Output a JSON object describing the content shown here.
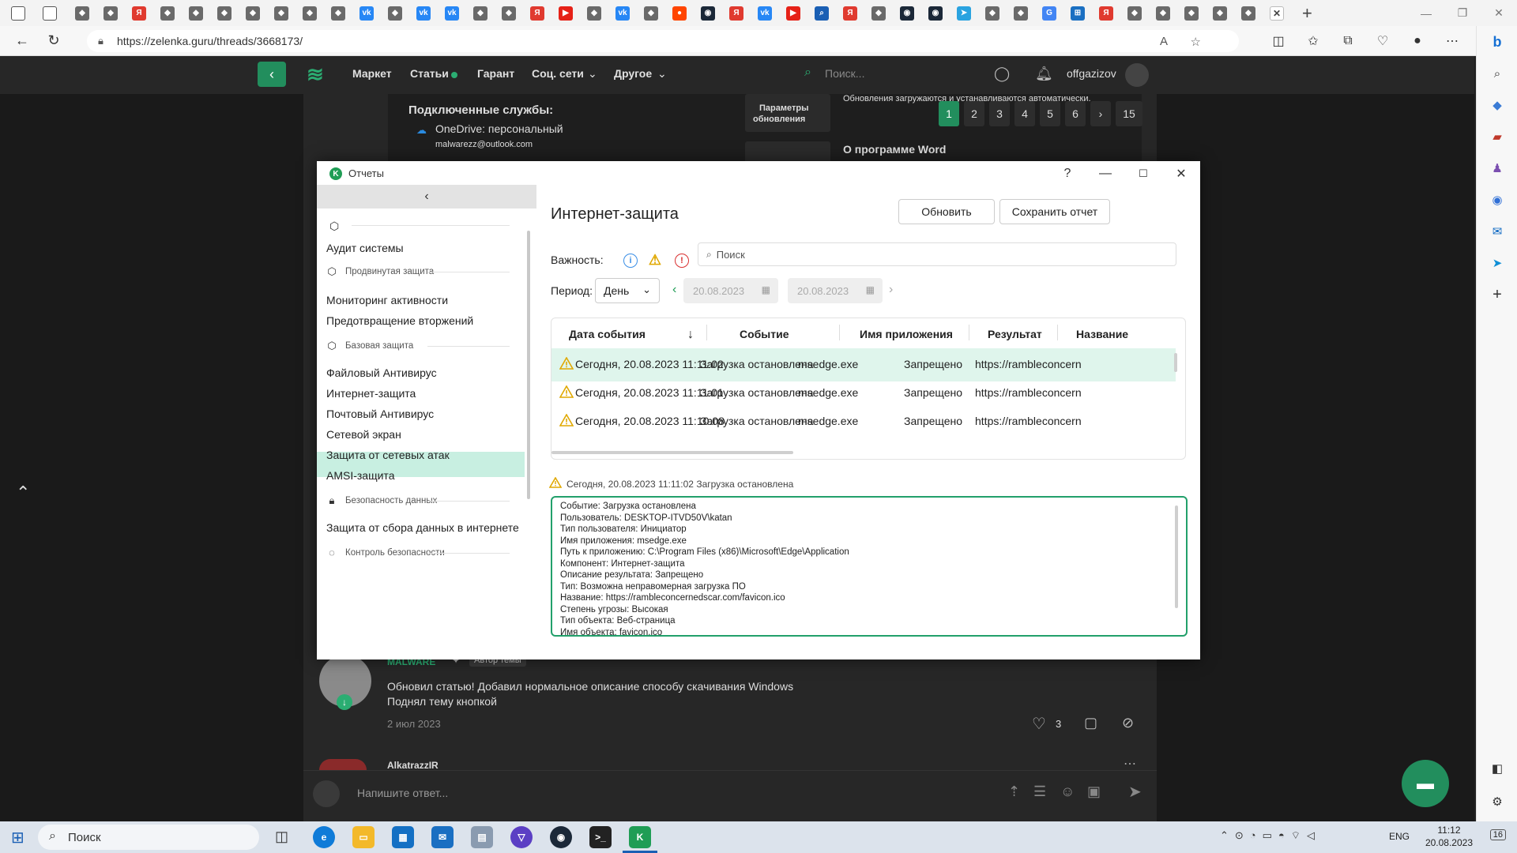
{
  "browser": {
    "url": "https://zelenka.guru/threads/3668173/",
    "tab_icons": [
      "tab-icon",
      "tab-icon",
      "yandex-icon",
      "tab-icon",
      "tab-icon",
      "tab-icon",
      "tab-icon",
      "tab-icon",
      "tab-icon",
      "tab-icon",
      "vk-icon",
      "tab-icon",
      "vk-icon",
      "vk-icon",
      "tab-icon",
      "tab-icon",
      "yandex-icon",
      "youtube-icon",
      "tab-icon",
      "vk-icon",
      "tab-icon",
      "reddit-icon",
      "steam-icon",
      "yandex-icon",
      "vk-icon",
      "youtube-icon",
      "search-icon",
      "yandex-icon",
      "tab-icon",
      "steam-icon",
      "steam-icon",
      "telegram-icon",
      "tab-icon",
      "tab-icon",
      "google-icon",
      "windows-icon",
      "yandex-icon",
      "tab-icon",
      "tab-icon",
      "tab-icon",
      "tab-icon",
      "tab-icon"
    ]
  },
  "site": {
    "nav": [
      "Маркет",
      "Статьи",
      "Гарант",
      "Соц. сети",
      "Другое"
    ],
    "search_placeholder": "Поиск...",
    "username": "offgazizov",
    "bg_snippets": {
      "connected_services": "Подключенные службы:",
      "onedrive": "OneDrive: персональный",
      "email": "malwarezz@outlook.com",
      "update_params_line1": "Параметры",
      "update_params_line2": "обновления",
      "updates_auto": "Обновления загружаются и устанавливаются автоматически.",
      "about_word": "О программе Word"
    },
    "pagination": [
      "1",
      "2",
      "3",
      "4",
      "5",
      "6",
      "›",
      "15"
    ],
    "post": {
      "author": "MALWARE",
      "badge": "Автор темы",
      "text_line1": "Обновил статью! Добавил нормальное описание способу скачивания Windows",
      "text_line2": "Поднял тему кнопкой",
      "date": "2 июл 2023",
      "likes": "3",
      "next_author": "AlkatrazzIR"
    },
    "reply_placeholder": "Напишите ответ..."
  },
  "kaspersky": {
    "window_title": "Отчеты",
    "help": "?",
    "sidebar": {
      "items": [
        {
          "type": "item",
          "label": "Аудит системы"
        },
        {
          "type": "group",
          "label": "Продвинутая защита"
        },
        {
          "type": "item",
          "label": "Мониторинг активности"
        },
        {
          "type": "item",
          "label": "Предотвращение вторжений"
        },
        {
          "type": "group",
          "label": "Базовая защита"
        },
        {
          "type": "item",
          "label": "Файловый Антивирус"
        },
        {
          "type": "item",
          "label": "Интернет-защита"
        },
        {
          "type": "item",
          "label": "Почтовый Антивирус"
        },
        {
          "type": "item",
          "label": "Сетевой экран"
        },
        {
          "type": "item",
          "label": "Защита от сетевых атак"
        },
        {
          "type": "item",
          "label": "AMSI-защита"
        },
        {
          "type": "group",
          "label": "Безопасность данных"
        },
        {
          "type": "item",
          "label": "Защита от сбора данных в интернете"
        },
        {
          "type": "group",
          "label": "Контроль безопасности"
        }
      ]
    },
    "heading": "Интернет-защита",
    "refresh_btn": "Обновить",
    "save_btn": "Сохранить отчет",
    "severity_label": "Важность:",
    "search_placeholder": "Поиск",
    "period_label": "Период:",
    "period_value": "День",
    "date_from": "20.08.2023",
    "date_to": "20.08.2023",
    "columns": [
      "Дата события",
      "Событие",
      "Имя приложения",
      "Результат",
      "Название"
    ],
    "rows": [
      {
        "date": "Сегодня, 20.08.2023 11:11:02",
        "event": "Загрузка остановлена",
        "app": "msedge.exe",
        "result": "Запрещено",
        "name": "https://rambleconcern"
      },
      {
        "date": "Сегодня, 20.08.2023 11:11:01",
        "event": "Загрузка остановлена",
        "app": "msedge.exe",
        "result": "Запрещено",
        "name": "https://rambleconcern"
      },
      {
        "date": "Сегодня, 20.08.2023 11:10:08",
        "event": "Загрузка остановлена",
        "app": "msedge.exe",
        "result": "Запрещено",
        "name": "https://rambleconcern"
      }
    ],
    "detail_title": "Сегодня, 20.08.2023 11:11:02 Загрузка остановлена",
    "detail_lines": [
      "Событие: Загрузка остановлена",
      "Пользователь: DESKTOP-ITVD50V\\katan",
      "Тип пользователя: Инициатор",
      "Имя приложения: msedge.exe",
      "Путь к приложению: C:\\Program Files (x86)\\Microsoft\\Edge\\Application",
      "Компонент: Интернет-защита",
      "Описание результата: Запрещено",
      "Тип: Возможна неправомерная загрузка ПО",
      "Название: https://rambleconcernedscar.com/favicon.ico",
      "Степень угрозы: Высокая",
      "Тип объекта: Веб-страница",
      "Имя объекта: favicon.ico"
    ]
  },
  "taskbar": {
    "search": "Поиск",
    "lang": "ENG",
    "time": "11:12",
    "date": "20.08.2023",
    "notifications": "16"
  },
  "colors": {
    "accent_green": "#228e5d",
    "kaspersky_selected": "#c8efe1",
    "kaspersky_detail_border": "#22a06b"
  }
}
